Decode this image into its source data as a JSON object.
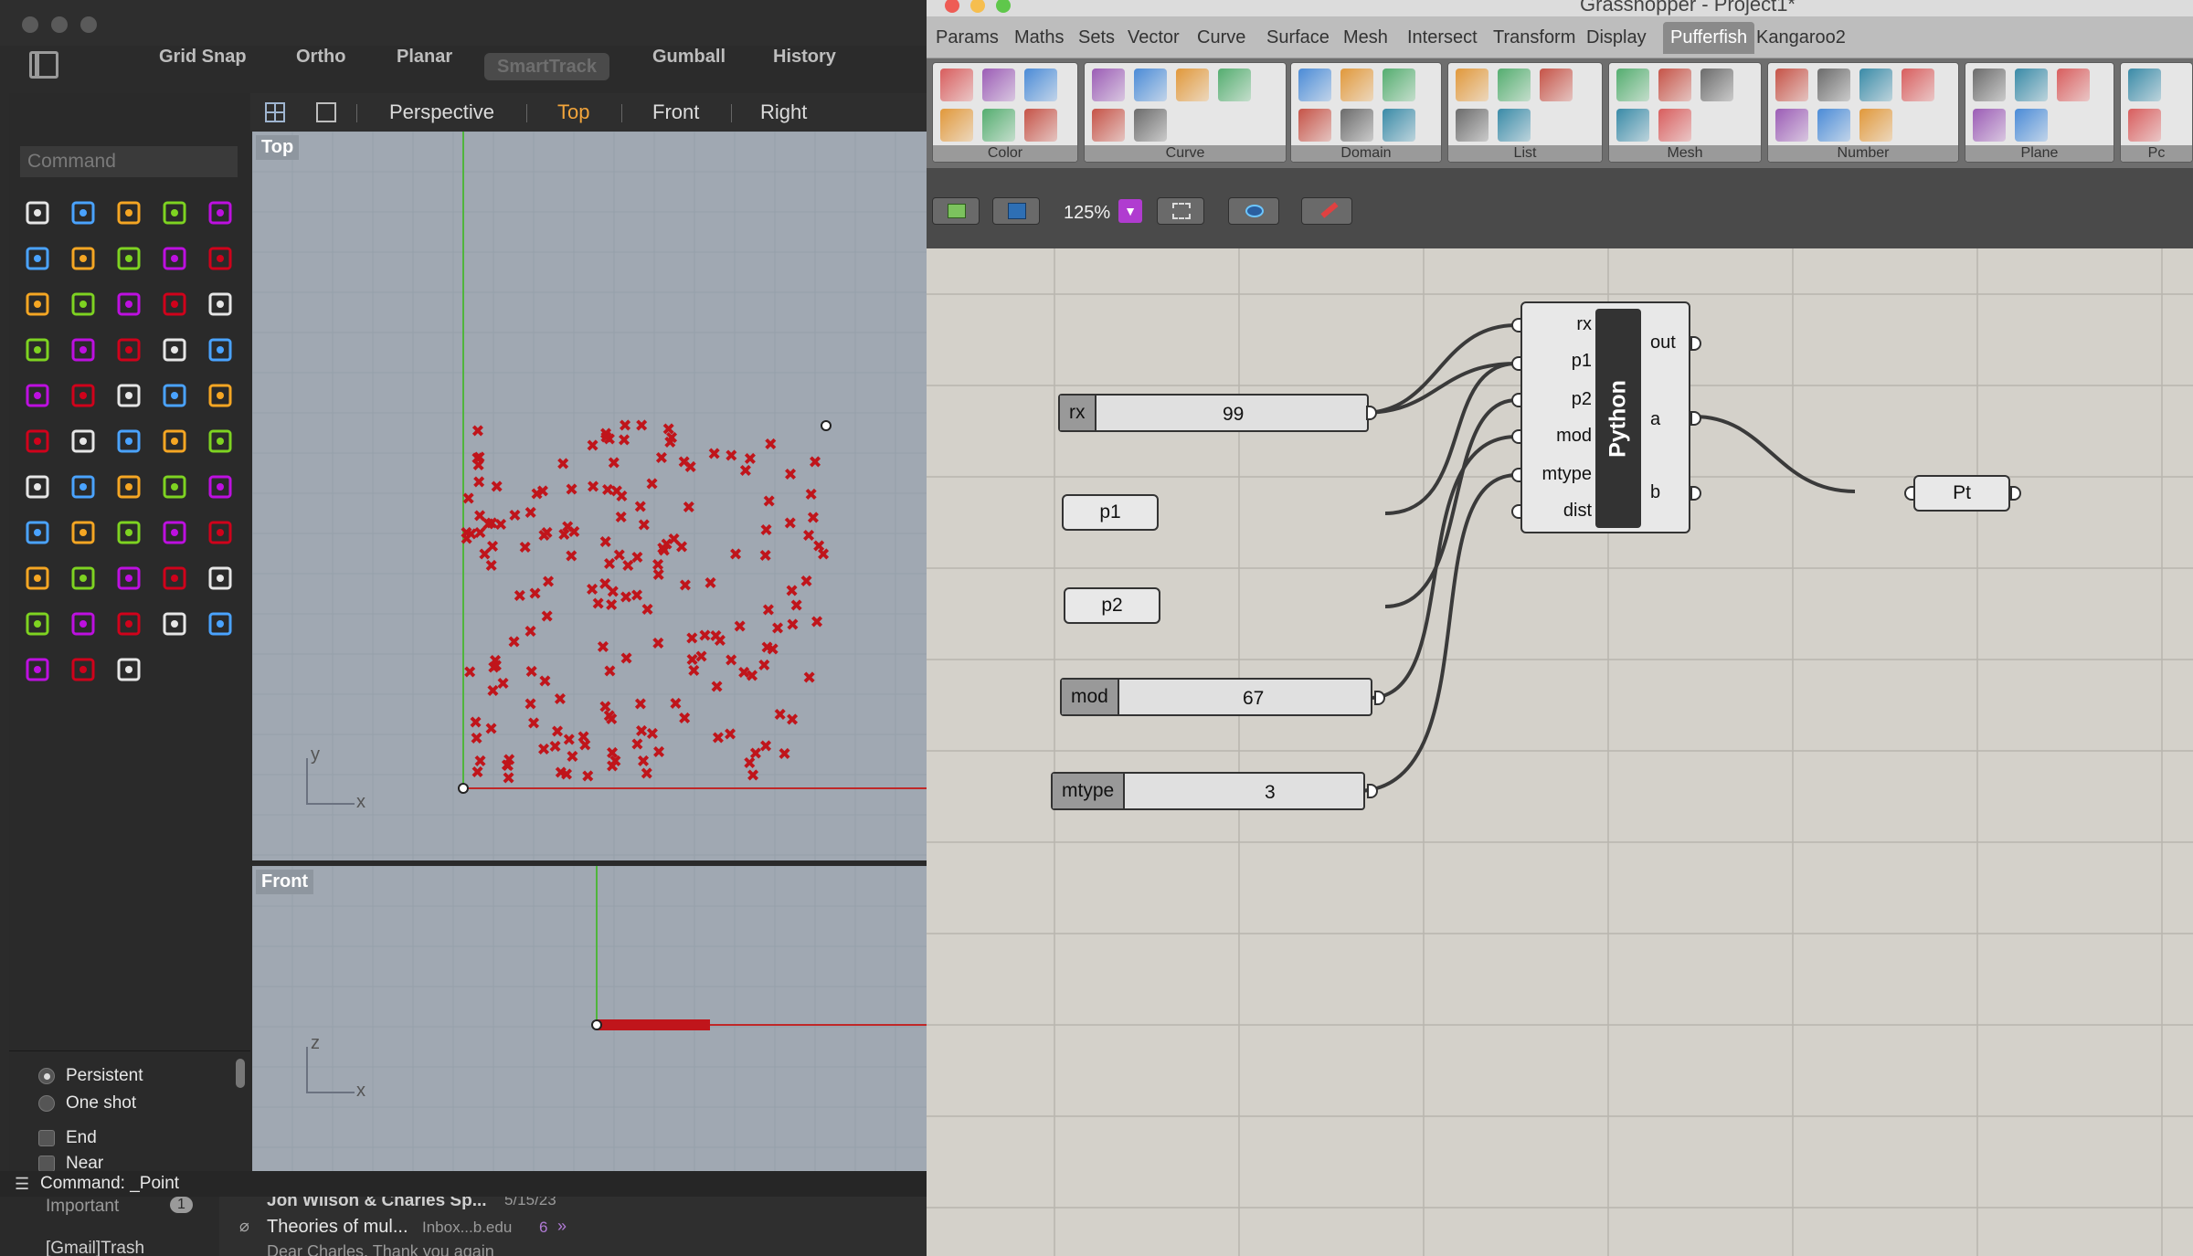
{
  "rhino": {
    "toolbar": [
      "Grid Snap",
      "Ortho",
      "Planar",
      "SmartTrack",
      "Gumball",
      "History"
    ],
    "command_placeholder": "Command",
    "viewport_tabs": [
      "Perspective",
      "Top",
      "Front",
      "Right"
    ],
    "active_tab": "Top",
    "top_viewport_label": "Top",
    "front_viewport_label": "Front",
    "axis_labels": {
      "x": "x",
      "y": "y",
      "z": "z"
    },
    "osnap": {
      "persistent": "Persistent",
      "one_shot": "One shot",
      "end": "End",
      "near": "Near"
    },
    "command_line": "Command: _Point",
    "mail": {
      "folder1": "Important",
      "folder1_count": "1",
      "folder2": "[Gmail]Trash",
      "sender_line": "Jon Wilson & Charles Sp...",
      "date": "5/15/23",
      "subject": "Theories of mul...",
      "mailbox": "Inbox...b.edu",
      "thread_count": "6",
      "preview": "Dear Charles, Thank you again"
    }
  },
  "grasshopper": {
    "title": "Grasshopper - Project1*",
    "menu": [
      "Params",
      "Maths",
      "Sets",
      "Vector",
      "Curve",
      "Surface",
      "Mesh",
      "Intersect",
      "Transform",
      "Display",
      "Pufferfish",
      "Kangaroo2"
    ],
    "active_menu": "Pufferfish",
    "ribbon_groups": [
      "Color",
      "Curve",
      "Domain",
      "List",
      "Mesh",
      "Number",
      "Plane",
      "Pc"
    ],
    "zoom": "125%",
    "sliders": [
      {
        "name": "rx",
        "value": "99"
      },
      {
        "name": "mod",
        "value": "67"
      },
      {
        "name": "mtype",
        "value": "3"
      }
    ],
    "params": {
      "p1": "p1",
      "p2": "p2",
      "pt": "Pt"
    },
    "python": {
      "label": "Python",
      "inputs": [
        "rx",
        "p1",
        "p2",
        "mod",
        "mtype",
        "dist"
      ],
      "outputs": [
        "out",
        "a",
        "b"
      ]
    }
  },
  "colors": {
    "accent_tab": "#f3a53b",
    "point": "#c0151b",
    "viewport_bg": "#a0a8b2",
    "gh_canvas": "#d4d1ca",
    "pufferfish_tab": "#8a8a8a"
  }
}
